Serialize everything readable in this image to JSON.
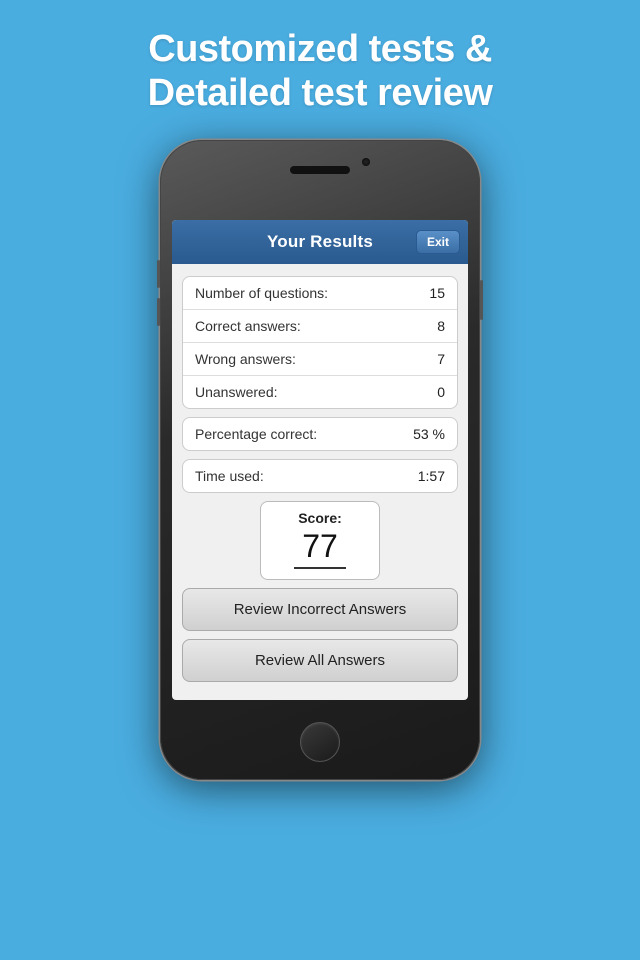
{
  "header": {
    "line1": "Customized tests &",
    "line2": "Detailed test review"
  },
  "phone": {
    "screen": {
      "title": "Your Results",
      "exit_label": "Exit",
      "results_group1": [
        {
          "label": "Number of questions:",
          "value": "15"
        },
        {
          "label": "Correct answers:",
          "value": "8"
        },
        {
          "label": "Wrong answers:",
          "value": "7"
        },
        {
          "label": "Unanswered:",
          "value": "0"
        }
      ],
      "results_group2": [
        {
          "label": "Percentage correct:",
          "value": "53 %"
        }
      ],
      "results_group3": [
        {
          "label": "Time used:",
          "value": "1:57"
        }
      ],
      "score": {
        "label": "Score:",
        "value": "77"
      },
      "buttons": [
        {
          "id": "review-incorrect",
          "label": "Review Incorrect Answers"
        },
        {
          "id": "review-all",
          "label": "Review All Answers"
        }
      ]
    }
  }
}
